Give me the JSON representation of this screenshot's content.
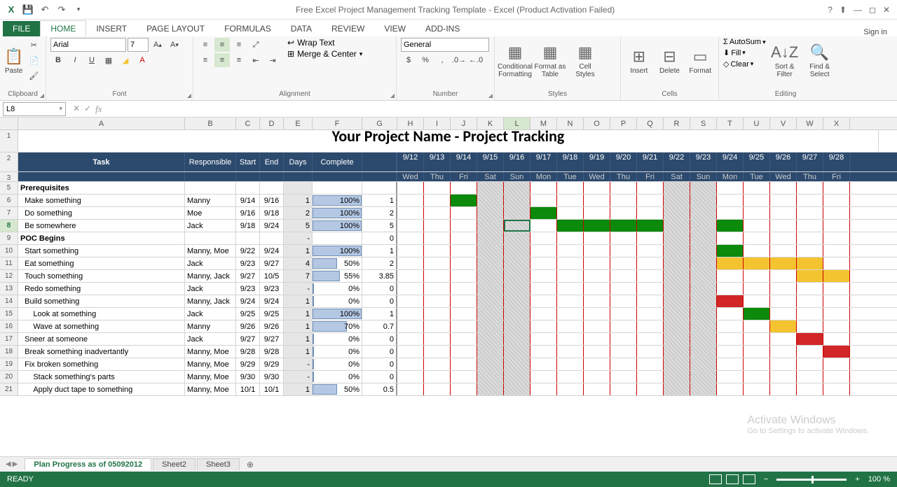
{
  "title": "Free Excel Project Management Tracking Template - Excel (Product Activation Failed)",
  "ribbon": {
    "tabs": [
      "FILE",
      "HOME",
      "INSERT",
      "PAGE LAYOUT",
      "FORMULAS",
      "DATA",
      "REVIEW",
      "VIEW",
      "ADD-INS"
    ],
    "active": "HOME",
    "signin": "Sign in",
    "clipboard": {
      "paste": "Paste",
      "label": "Clipboard"
    },
    "font": {
      "name": "Arial",
      "size": "7",
      "label": "Font",
      "bold": "B",
      "italic": "I",
      "underline": "U"
    },
    "alignment": {
      "label": "Alignment",
      "wrap": "Wrap Text",
      "merge": "Merge & Center"
    },
    "number": {
      "label": "Number",
      "format": "General"
    },
    "styles": {
      "label": "Styles",
      "cf": "Conditional Formatting",
      "fat": "Format as Table",
      "cs": "Cell Styles"
    },
    "cells": {
      "label": "Cells",
      "insert": "Insert",
      "delete": "Delete",
      "format": "Format"
    },
    "editing": {
      "label": "Editing",
      "autosum": "AutoSum",
      "fill": "Fill",
      "clear": "Clear",
      "sort": "Sort & Filter",
      "find": "Find & Select"
    }
  },
  "namebox": "L8",
  "columns": [
    "A",
    "B",
    "C",
    "D",
    "E",
    "F",
    "G",
    "H",
    "I",
    "J",
    "K",
    "L",
    "M",
    "N",
    "O",
    "P",
    "Q",
    "R",
    "S",
    "T",
    "U",
    "V",
    "W",
    "X"
  ],
  "project_title": "Your Project Name - Project Tracking",
  "header": {
    "task": "Task",
    "resp": "Responsible",
    "start": "Start",
    "end": "End",
    "days": "Days",
    "complete": "Complete",
    "dates": [
      "9/12",
      "9/13",
      "9/14",
      "9/15",
      "9/16",
      "9/17",
      "9/18",
      "9/19",
      "9/20",
      "9/21",
      "9/22",
      "9/23",
      "9/24",
      "9/25",
      "9/26",
      "9/27",
      "9/28"
    ],
    "dows": [
      "Wed",
      "Thu",
      "Fri",
      "Sat",
      "Sun",
      "Mon",
      "Tue",
      "Wed",
      "Thu",
      "Fri",
      "Sat",
      "Sun",
      "Mon",
      "Tue",
      "Wed",
      "Thu",
      "Fri"
    ]
  },
  "rows": [
    {
      "n": 5,
      "section": true,
      "task": "Prerequisites"
    },
    {
      "n": 6,
      "task": "Make something",
      "resp": "Manny",
      "start": "9/14",
      "end": "9/16",
      "days": "1",
      "pct": 100,
      "g": "1",
      "gantt": [
        {
          "i": 2,
          "c": "g"
        }
      ]
    },
    {
      "n": 7,
      "task": "Do something",
      "resp": "Moe",
      "start": "9/16",
      "end": "9/18",
      "days": "2",
      "pct": 100,
      "g": "2",
      "gantt": [
        {
          "i": 4,
          "c": "g"
        },
        {
          "i": 5,
          "c": "g"
        }
      ]
    },
    {
      "n": 8,
      "task": "Be somewhere",
      "resp": "Jack",
      "start": "9/18",
      "end": "9/24",
      "days": "5",
      "pct": 100,
      "g": "5",
      "sel": true,
      "gantt": [
        {
          "i": 6,
          "c": "g"
        },
        {
          "i": 7,
          "c": "g"
        },
        {
          "i": 8,
          "c": "g"
        },
        {
          "i": 9,
          "c": "g"
        },
        {
          "i": 12,
          "c": "g"
        }
      ]
    },
    {
      "n": 9,
      "section": true,
      "task": "POC Begins",
      "days": "-",
      "g": "0"
    },
    {
      "n": 10,
      "task": "Start something",
      "resp": "Manny, Moe",
      "start": "9/22",
      "end": "9/24",
      "days": "1",
      "pct": 100,
      "g": "1",
      "gantt": [
        {
          "i": 12,
          "c": "g"
        }
      ]
    },
    {
      "n": 11,
      "task": "Eat something",
      "resp": "Jack",
      "start": "9/23",
      "end": "9/27",
      "days": "4",
      "pct": 50,
      "g": "2",
      "gantt": [
        {
          "i": 12,
          "c": "y"
        },
        {
          "i": 13,
          "c": "y"
        },
        {
          "i": 14,
          "c": "y"
        },
        {
          "i": 15,
          "c": "y"
        }
      ]
    },
    {
      "n": 12,
      "task": "Touch something",
      "resp": "Manny, Jack",
      "start": "9/27",
      "end": "10/5",
      "days": "7",
      "pct": 55,
      "g": "3.85",
      "gantt": [
        {
          "i": 15,
          "c": "y"
        },
        {
          "i": 16,
          "c": "y"
        }
      ]
    },
    {
      "n": 13,
      "task": "Redo something",
      "resp": "Jack",
      "start": "9/23",
      "end": "9/23",
      "days": "-",
      "pct": 0,
      "g": "0"
    },
    {
      "n": 14,
      "task": "Build something",
      "resp": "Manny, Jack",
      "start": "9/24",
      "end": "9/24",
      "days": "1",
      "pct": 0,
      "g": "0",
      "gantt": [
        {
          "i": 12,
          "c": "r"
        }
      ]
    },
    {
      "n": 15,
      "task": "Look at something",
      "resp": "Jack",
      "start": "9/25",
      "end": "9/25",
      "days": "1",
      "pct": 100,
      "g": "1",
      "gantt": [
        {
          "i": 13,
          "c": "g"
        }
      ]
    },
    {
      "n": 16,
      "task": "Wave at something",
      "resp": "Manny",
      "start": "9/26",
      "end": "9/26",
      "days": "1",
      "pct": 70,
      "g": "0.7",
      "gantt": [
        {
          "i": 14,
          "c": "y"
        }
      ]
    },
    {
      "n": 17,
      "task": "Sneer at someone",
      "resp": "Jack",
      "start": "9/27",
      "end": "9/27",
      "days": "1",
      "pct": 0,
      "g": "0",
      "gantt": [
        {
          "i": 15,
          "c": "r"
        }
      ]
    },
    {
      "n": 18,
      "task": "Break something inadvertantly",
      "resp": "Manny, Moe",
      "start": "9/28",
      "end": "9/28",
      "days": "1",
      "pct": 0,
      "g": "0",
      "gantt": [
        {
          "i": 16,
          "c": "r"
        }
      ]
    },
    {
      "n": 19,
      "task": "Fix broken something",
      "resp": "Manny, Moe",
      "start": "9/29",
      "end": "9/29",
      "days": "-",
      "pct": 0,
      "g": "0"
    },
    {
      "n": 20,
      "task": "Stack something's parts",
      "resp": "Manny, Moe",
      "start": "9/30",
      "end": "9/30",
      "days": "-",
      "pct": 0,
      "g": "0"
    },
    {
      "n": 21,
      "task": "Apply duct tape to something",
      "resp": "Manny, Moe",
      "start": "10/1",
      "end": "10/1",
      "days": "1",
      "pct": 50,
      "g": "0.5"
    }
  ],
  "weekend_cols": [
    3,
    4,
    10,
    11
  ],
  "sheets": {
    "active": "Plan Progress as of 05092012",
    "others": [
      "Sheet2",
      "Sheet3"
    ]
  },
  "status": "READY",
  "zoom": "100 %",
  "watermark": {
    "t": "Activate Windows",
    "s": "Go to Settings to activate Windows."
  }
}
